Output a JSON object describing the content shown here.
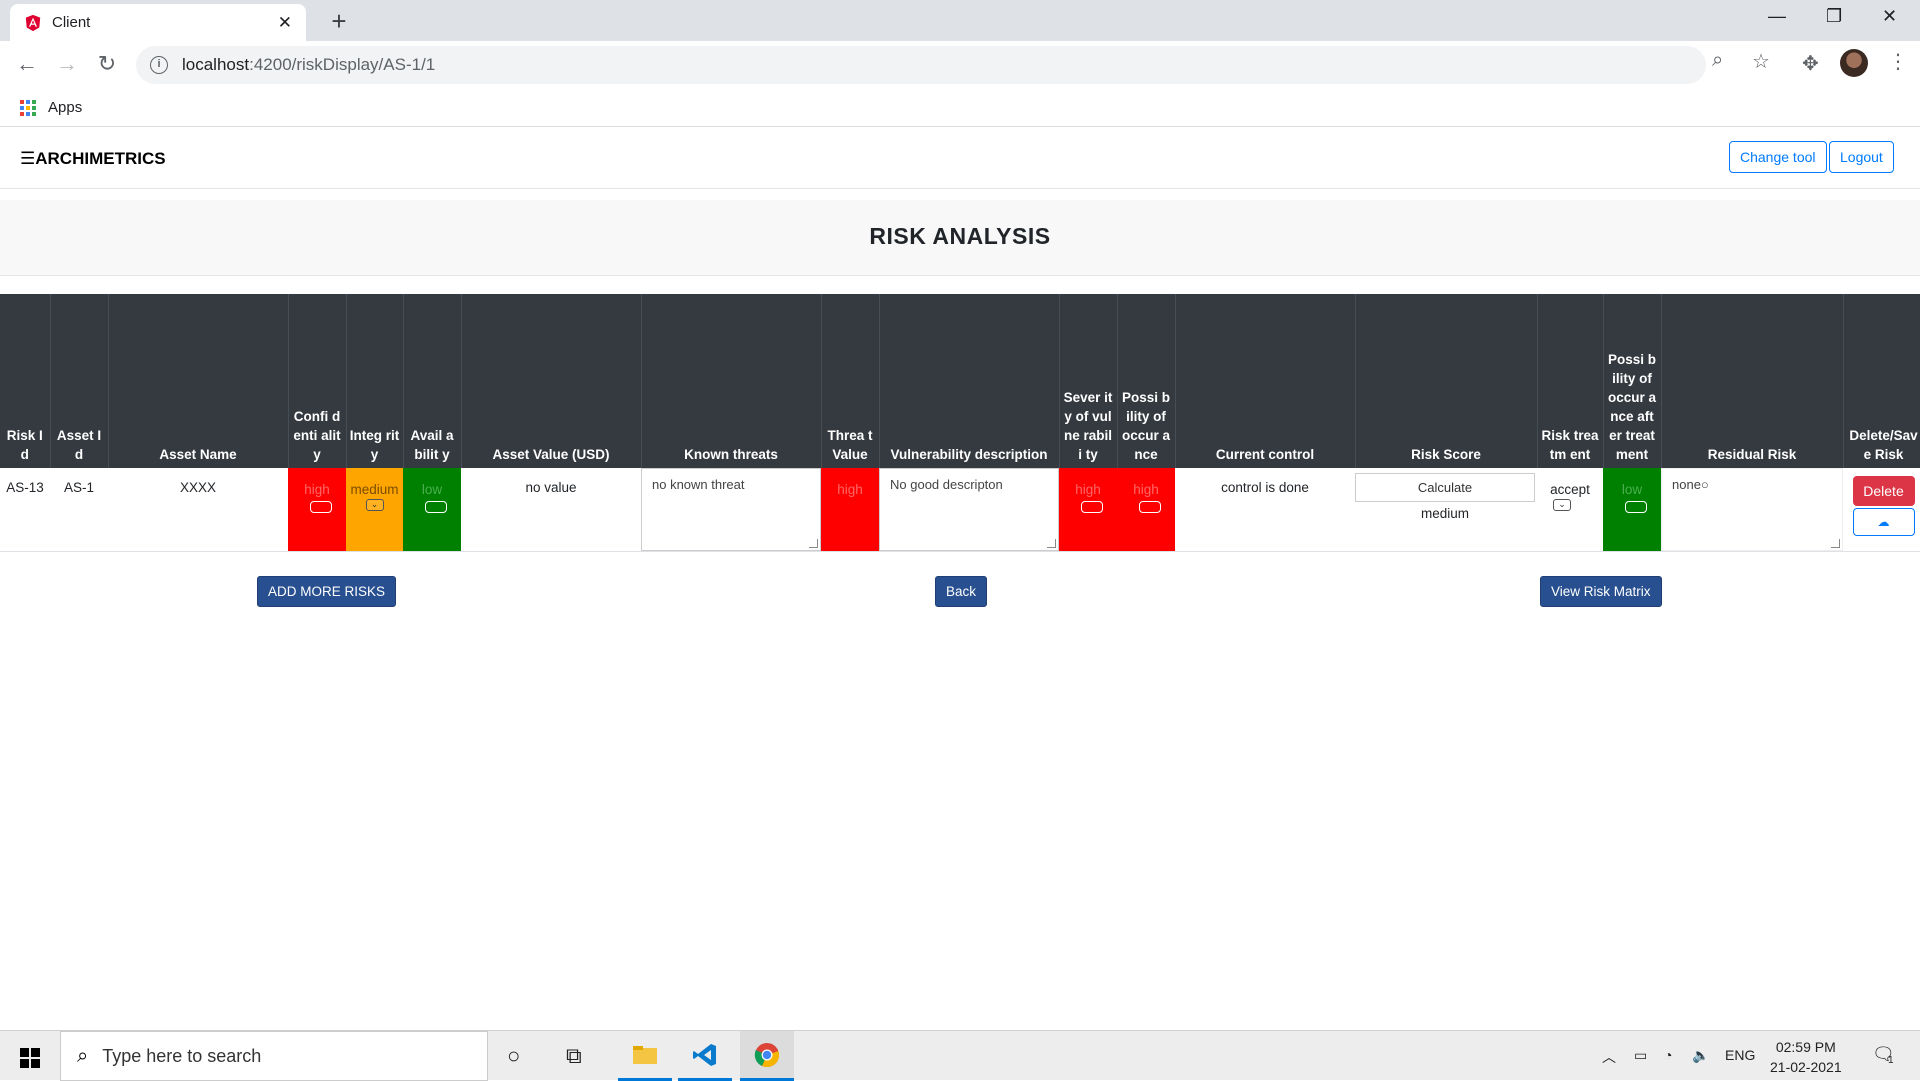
{
  "browser": {
    "tab_title": "Client",
    "url_host": "localhost",
    "url_rest": ":4200/riskDisplay/AS-1/1",
    "bookmarks_apps": "Apps"
  },
  "app": {
    "brand": "☰ARCHIMETRICS",
    "change_tool": "Change tool",
    "logout": "Logout",
    "page_title": "RISK ANALYSIS"
  },
  "table": {
    "headers": [
      "Risk Id",
      "Asset Id",
      "Asset Name",
      "Confi denti ality",
      "Integ rity",
      "Avail abilit y",
      "Asset Value (USD)",
      "Known threats",
      "Threa t Value",
      "Vulnerability description",
      "Sever ity of vulne rabili ty",
      "Possi bility of occur ance",
      "Current control",
      "Risk Score",
      "Risk treatm ent",
      "Possi bility of occur ance after treat ment",
      "Residual Risk",
      "Delete/Sav e Risk"
    ],
    "row": {
      "risk_id": "AS-13",
      "asset_id": "AS-1",
      "asset_name": "XXXX",
      "confidentiality": "high",
      "integrity": "medium",
      "availability": "low",
      "asset_value": "no value",
      "known_threats": "no known threat",
      "threat_value": "high",
      "vulnerability": "No good descripton",
      "severity": "high",
      "possibility": "high",
      "current_control": "control is done",
      "calculate": "Calculate",
      "risk_score": "medium",
      "treatment": "accept",
      "possibility_after": "low",
      "residual_risk": "none",
      "delete": "Delete"
    }
  },
  "buttons": {
    "add_more": "ADD MORE RISKS",
    "back": "Back",
    "view_matrix": "View Risk Matrix"
  },
  "taskbar": {
    "search_placeholder": "Type here to search",
    "lang": "ENG",
    "time": "02:59 PM",
    "date": "21-02-2021",
    "notif_count": "1"
  }
}
